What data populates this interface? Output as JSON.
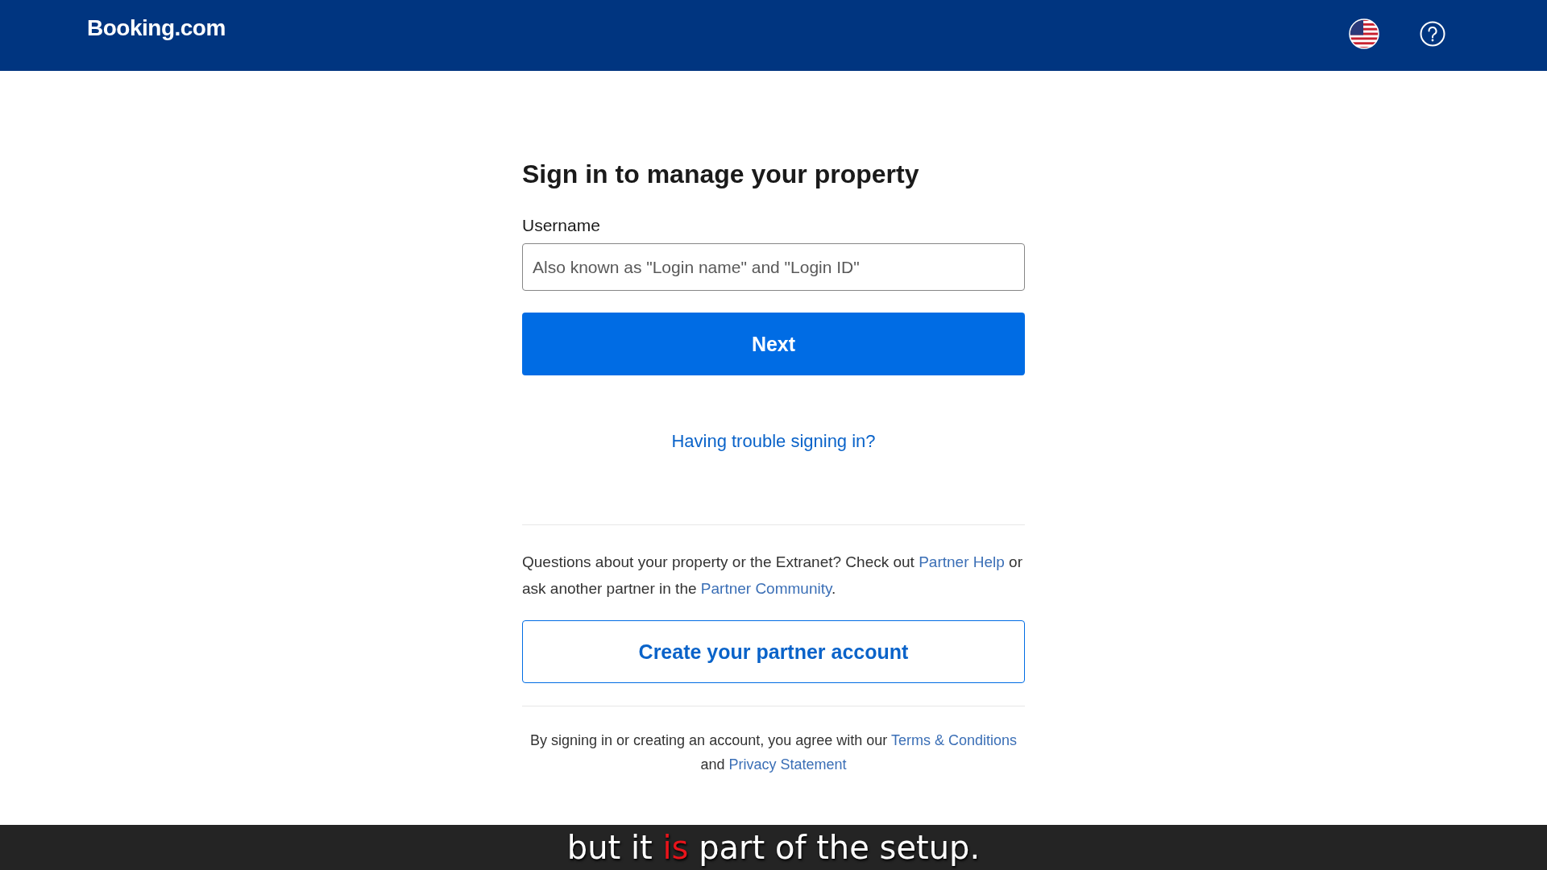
{
  "header": {
    "logo": "Booking.com"
  },
  "title": "Sign in to manage your property",
  "username": {
    "label": "Username",
    "placeholder": "Also known as \"Login name\" and \"Login ID\""
  },
  "next_button": "Next",
  "trouble_link": "Having trouble signing in?",
  "help_text": [
    {
      "kind": "text",
      "text": "Questions about your property or the Extranet? Check out "
    },
    {
      "kind": "link",
      "text": "Partner Help"
    },
    {
      "kind": "text",
      "text": " or ask another partner in the "
    },
    {
      "kind": "link",
      "text": "Partner Community"
    },
    {
      "kind": "text",
      "text": "."
    }
  ],
  "create_button": "Create your partner account",
  "terms_text": [
    {
      "kind": "text",
      "text": "By signing in or creating an account, you agree with our "
    },
    {
      "kind": "link",
      "text": "Terms & Conditions"
    },
    {
      "kind": "text",
      "text": " and "
    },
    {
      "kind": "link",
      "text": "Privacy Statement"
    }
  ],
  "caption": [
    {
      "text": "but it ",
      "highlight": false
    },
    {
      "text": "is",
      "highlight": true
    },
    {
      "text": " part of the setup.",
      "highlight": false
    }
  ]
}
